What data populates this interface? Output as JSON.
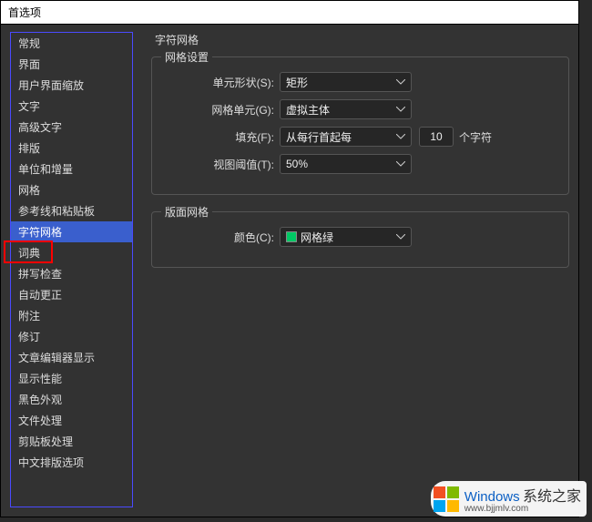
{
  "title_bar": "首选项",
  "sidebar": {
    "items": [
      "常规",
      "界面",
      "用户界面缩放",
      "文字",
      "高级文字",
      "排版",
      "单位和增量",
      "网格",
      "参考线和粘贴板",
      "字符网格",
      "词典",
      "拼写检查",
      "自动更正",
      "附注",
      "修订",
      "文章编辑器显示",
      "显示性能",
      "黑色外观",
      "文件处理",
      "剪贴板处理",
      "中文排版选项"
    ],
    "selected_index": 9,
    "highlighted_index": 10
  },
  "main": {
    "title": "字符网格",
    "grid_settings": {
      "legend": "网格设置",
      "cell_shape_label": "单元形状(S):",
      "cell_shape_value": "矩形",
      "grid_unit_label": "网格单元(G):",
      "grid_unit_value": "虚拟主体",
      "fill_label": "填充(F):",
      "fill_value": "从每行首起每",
      "fill_count": "10",
      "fill_suffix": "个字符",
      "view_threshold_label": "视图阈值(T):",
      "view_threshold_value": "50%"
    },
    "layout_grid": {
      "legend": "版面网格",
      "color_label": "颜色(C):",
      "color_name": "网格绿"
    }
  },
  "watermark": {
    "brand_main": "Windows",
    "brand_sub": "系统之家",
    "url": "www.bjjmlv.com"
  }
}
